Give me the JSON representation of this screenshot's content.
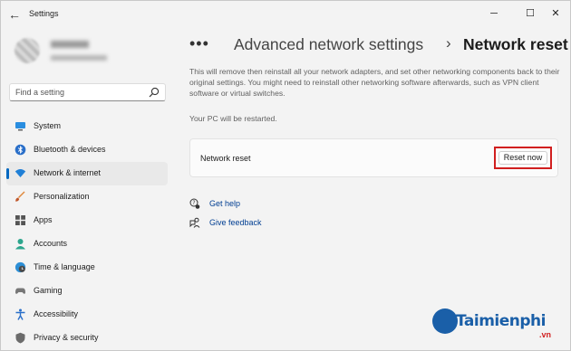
{
  "window": {
    "title": "Settings",
    "controls": [
      "minimize",
      "maximize",
      "close"
    ]
  },
  "search": {
    "placeholder": "Find a setting"
  },
  "sidebar": {
    "items": [
      {
        "label": "System",
        "icon": "monitor-icon",
        "active": false
      },
      {
        "label": "Bluetooth & devices",
        "icon": "bluetooth-icon",
        "active": false
      },
      {
        "label": "Network & internet",
        "icon": "wifi-icon",
        "active": true
      },
      {
        "label": "Personalization",
        "icon": "brush-icon",
        "active": false
      },
      {
        "label": "Apps",
        "icon": "apps-icon",
        "active": false
      },
      {
        "label": "Accounts",
        "icon": "person-icon",
        "active": false
      },
      {
        "label": "Time & language",
        "icon": "globe-clock-icon",
        "active": false
      },
      {
        "label": "Gaming",
        "icon": "gamepad-icon",
        "active": false
      },
      {
        "label": "Accessibility",
        "icon": "accessibility-icon",
        "active": false
      },
      {
        "label": "Privacy & security",
        "icon": "shield-icon",
        "active": false
      }
    ]
  },
  "breadcrumb": {
    "more": "•••",
    "parent": "Advanced network settings",
    "separator": "›",
    "current": "Network reset"
  },
  "main": {
    "description": "This will remove then reinstall all your network adapters, and set other networking components back to their original settings. You might need to reinstall other networking software afterwards, such as VPN client software or virtual switches.",
    "restart_note": "Your PC will be restarted.",
    "card": {
      "label": "Network reset",
      "button": "Reset now"
    },
    "links": {
      "help": "Get help",
      "feedback": "Give feedback"
    }
  },
  "watermark": {
    "brand": "Taimienphi",
    "suffix": ".vn"
  },
  "colors": {
    "accent": "#0067c0",
    "highlight_border": "#d11f1f",
    "link": "#003e92",
    "watermark": "#1a5fa8"
  }
}
